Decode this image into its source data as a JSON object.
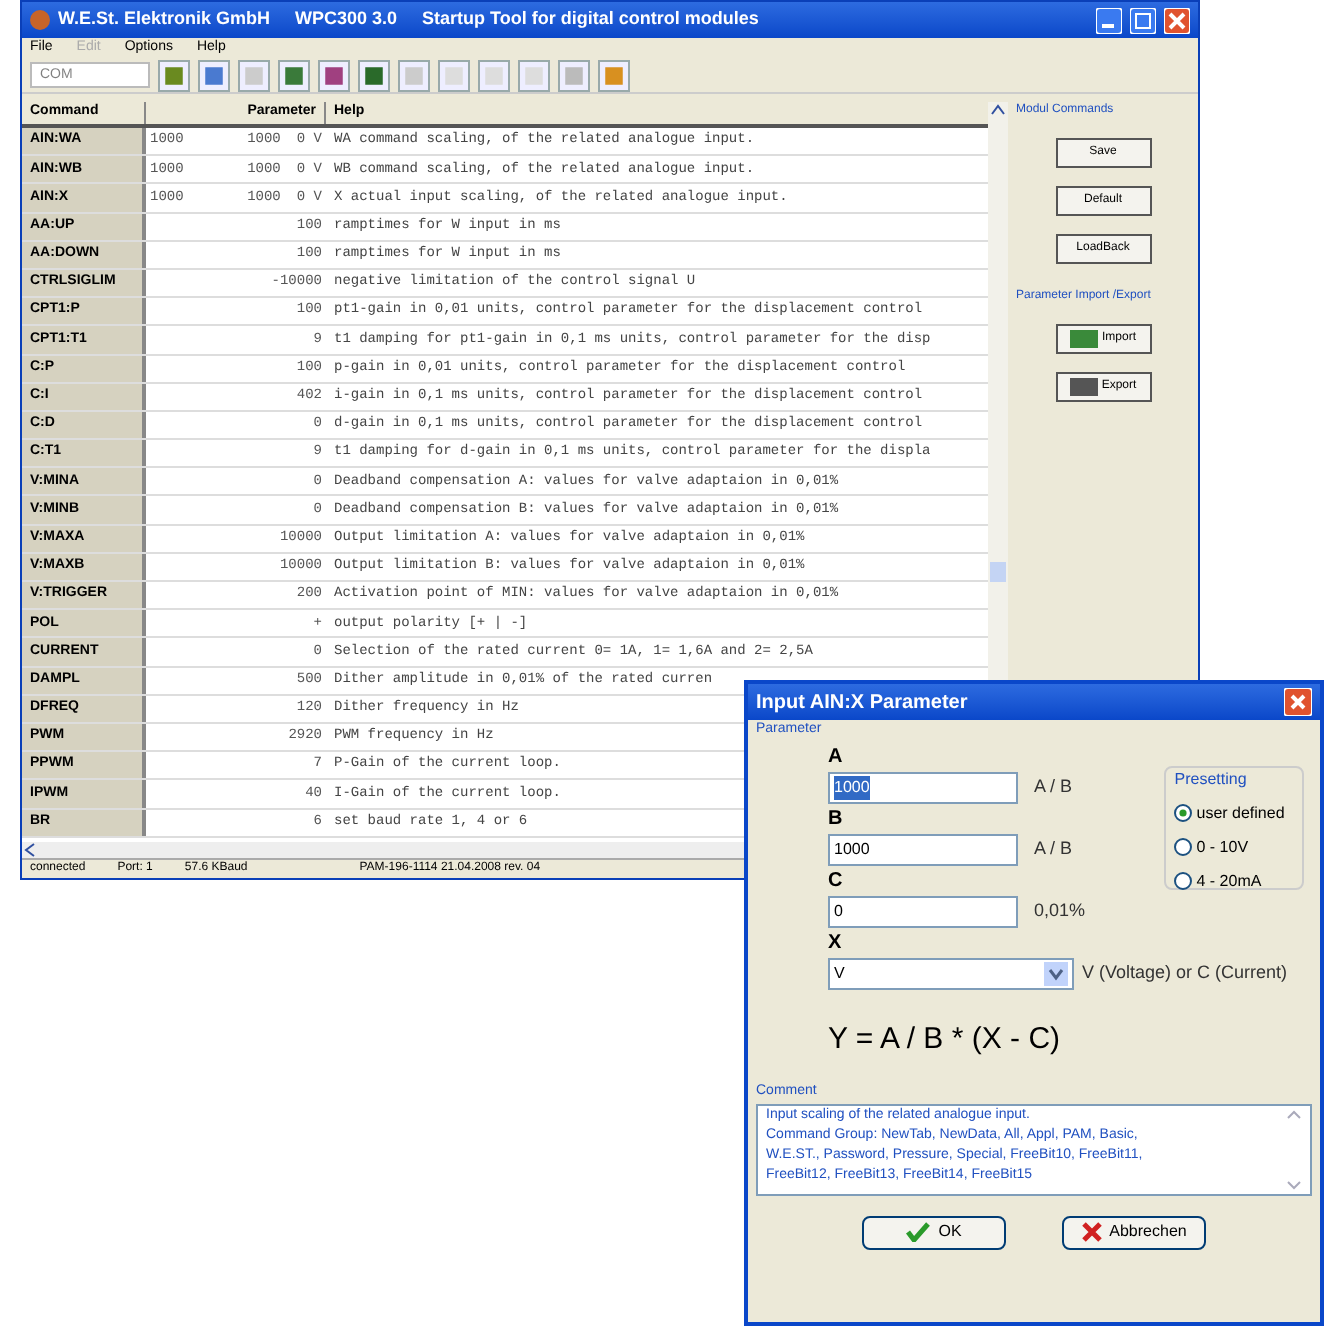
{
  "window": {
    "title": "W.E.St. Elektronik GmbH     WPC300 3.0     Startup Tool for digital control modules"
  },
  "menu": [
    {
      "label": "File",
      "disabled": false
    },
    {
      "label": "Edit",
      "disabled": true
    },
    {
      "label": "Options",
      "disabled": false
    },
    {
      "label": "Help",
      "disabled": false
    }
  ],
  "toolbar": {
    "port_placeholder": "COM"
  },
  "table": {
    "columns": [
      "Command",
      "Parameter",
      "Help"
    ],
    "rows": [
      {
        "command": "AIN:WA",
        "params": [
          "1000",
          "1000",
          "0 V"
        ],
        "help": "WA command scaling, of the related analogue input."
      },
      {
        "command": "AIN:WB",
        "params": [
          "1000",
          "1000",
          "0 V"
        ],
        "help": "WB command scaling, of the related analogue input."
      },
      {
        "command": "AIN:X",
        "params": [
          "1000",
          "1000",
          "0 V"
        ],
        "help": "X actual input scaling, of the related analogue input."
      },
      {
        "command": "AA:UP",
        "params": [
          "100"
        ],
        "help": "ramptimes for W input in ms"
      },
      {
        "command": "AA:DOWN",
        "params": [
          "100"
        ],
        "help": "ramptimes for W input in ms"
      },
      {
        "command": "CTRLSIGLIM",
        "params": [
          "-10000"
        ],
        "help": "negative limitation of the control signal U"
      },
      {
        "command": "CPT1:P",
        "params": [
          "100"
        ],
        "help": "pt1-gain in 0,01 units, control parameter for the displacement control"
      },
      {
        "command": "CPT1:T1",
        "params": [
          "9"
        ],
        "help": "t1 damping for pt1-gain in 0,1 ms units, control parameter for the disp"
      },
      {
        "command": "C:P",
        "params": [
          "100"
        ],
        "help": "p-gain in 0,01 units, control parameter for the displacement control"
      },
      {
        "command": "C:I",
        "params": [
          "402"
        ],
        "help": "i-gain in 0,1 ms units, control parameter for the displacement control"
      },
      {
        "command": "C:D",
        "params": [
          "0"
        ],
        "help": "d-gain in 0,1 ms units, control parameter for the displacement control"
      },
      {
        "command": "C:T1",
        "params": [
          "9"
        ],
        "help": "t1 damping for d-gain in 0,1 ms units, control parameter for the displa"
      },
      {
        "command": "V:MINA",
        "params": [
          "0"
        ],
        "help": "Deadband compensation A: values for valve adaptaion in 0,01%"
      },
      {
        "command": "V:MINB",
        "params": [
          "0"
        ],
        "help": "Deadband compensation B: values for valve adaptaion in 0,01%"
      },
      {
        "command": "V:MAXA",
        "params": [
          "10000"
        ],
        "help": "Output limitation A: values for valve adaptaion in 0,01%"
      },
      {
        "command": "V:MAXB",
        "params": [
          "10000"
        ],
        "help": "Output limitation B: values for valve adaptaion in 0,01%"
      },
      {
        "command": "V:TRIGGER",
        "params": [
          "200"
        ],
        "help": "Activation point of MIN: values for valve adaptaion in 0,01%"
      },
      {
        "command": "POL",
        "params": [
          "+"
        ],
        "help": "output polarity [+ | -]"
      },
      {
        "command": "CURRENT",
        "params": [
          "0"
        ],
        "help": "Selection of the rated current 0= 1A, 1= 1,6A and 2= 2,5A"
      },
      {
        "command": "DAMPL",
        "params": [
          "500"
        ],
        "help": "Dither amplitude in 0,01% of the rated curren"
      },
      {
        "command": "DFREQ",
        "params": [
          "120"
        ],
        "help": "Dither frequency in Hz"
      },
      {
        "command": "PWM",
        "params": [
          "2920"
        ],
        "help": "PWM frequency in Hz"
      },
      {
        "command": "PPWM",
        "params": [
          "7"
        ],
        "help": "P-Gain of the current loop."
      },
      {
        "command": "IPWM",
        "params": [
          "40"
        ],
        "help": "I-Gain of the current loop."
      },
      {
        "command": "BR",
        "params": [
          "6"
        ],
        "help": "set baud rate 1, 4 or 6"
      }
    ]
  },
  "side_panel": {
    "groups": [
      {
        "title": "Modul Commands",
        "buttons": [
          {
            "label": "Save",
            "kind": "text"
          },
          {
            "label": "Default",
            "kind": "text"
          },
          {
            "label": "LoadBack",
            "kind": "text"
          }
        ]
      },
      {
        "title": "Parameter Import /Export",
        "buttons": [
          {
            "label": "Import",
            "kind": "import"
          },
          {
            "label": "Export",
            "kind": "export"
          }
        ]
      }
    ]
  },
  "status_bar": [
    "connected",
    "Port: 1",
    "57.6 KBaud",
    "PAM-196-1114 21.04.2008 rev. 04"
  ],
  "dialog": {
    "title": "Input AIN:X Parameter",
    "group": "Parameter",
    "fields": [
      {
        "label": "A",
        "value": "1000",
        "unit": "A / B",
        "selected": true
      },
      {
        "label": "B",
        "value": "1000",
        "unit": "A / B",
        "selected": false
      },
      {
        "label": "C",
        "value": "0",
        "unit": "0,01%",
        "selected": false
      }
    ],
    "select": {
      "label": "X",
      "value": "V",
      "hint": "V (Voltage) or C (Current)"
    },
    "presetting": {
      "title": "Presetting",
      "options": [
        {
          "label": "user defined",
          "selected": true
        },
        {
          "label": "0 - 10V",
          "selected": false
        },
        {
          "label": "4 - 20mA",
          "selected": false
        }
      ]
    },
    "formula": "Y = A / B * (X - C)",
    "comment": {
      "title": "Comment",
      "lines": [
        "Input scaling of the related analogue input.",
        "Command Group: NewTab, NewData, All, Appl, PAM, Basic,",
        "W.E.ST., Password, Pressure, Special, FreeBit10, FreeBit11,",
        "FreeBit12, FreeBit13, FreeBit14, FreeBit15"
      ]
    },
    "ok": "OK",
    "cancel": "Abbrechen"
  }
}
